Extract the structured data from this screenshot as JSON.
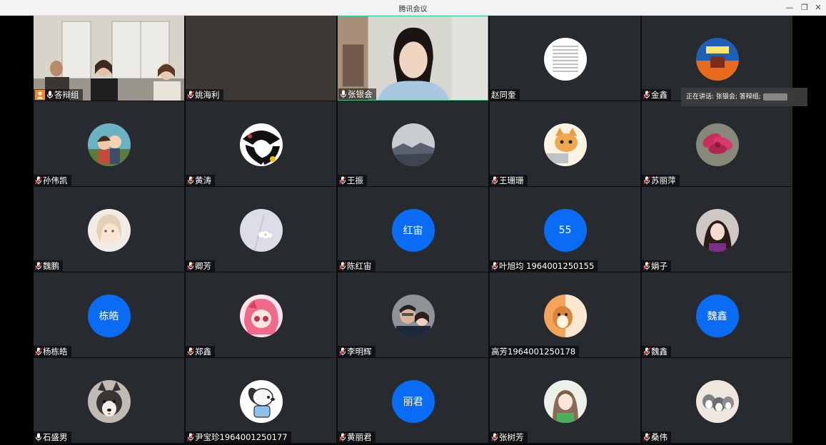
{
  "window": {
    "title": "腾讯会议"
  },
  "speaking_banner": {
    "text": "正在讲话: 张银会; 答辩组;"
  },
  "participants": [
    {
      "name": "答辩组",
      "host": true,
      "mic": "on",
      "type": "video"
    },
    {
      "name": "姚海利",
      "mic": "off",
      "type": "blank"
    },
    {
      "name": "张银会",
      "mic": "on",
      "type": "video",
      "active": true
    },
    {
      "name": "赵同奎",
      "mic": "none",
      "type": "avatar",
      "avatar_icon": "document-avatar"
    },
    {
      "name": "金鑫",
      "mic": "off",
      "type": "avatar",
      "avatar_icon": "building-avatar"
    },
    {
      "name": "孙伟凯",
      "mic": "off",
      "type": "avatar",
      "avatar_icon": "cartoon-couple-avatar"
    },
    {
      "name": "黄涛",
      "mic": "off",
      "type": "avatar",
      "avatar_icon": "pattern-avatar"
    },
    {
      "name": "王振",
      "mic": "off",
      "type": "avatar",
      "avatar_icon": "snow-mountain-avatar"
    },
    {
      "name": "王珊珊",
      "mic": "off",
      "type": "avatar",
      "avatar_icon": "cat-avatar"
    },
    {
      "name": "苏丽萍",
      "mic": "off",
      "type": "avatar",
      "avatar_icon": "flower-avatar"
    },
    {
      "name": "魏鹏",
      "mic": "off",
      "type": "avatar",
      "avatar_icon": "girl-drawing-avatar"
    },
    {
      "name": "卿芳",
      "mic": "off",
      "type": "avatar",
      "avatar_icon": "white-flower-avatar"
    },
    {
      "name": "陈红宙",
      "mic": "off",
      "type": "text",
      "avatar_text": "红宙"
    },
    {
      "name": "叶旭均 1964001250155",
      "mic": "off",
      "type": "text",
      "avatar_text": "55"
    },
    {
      "name": "娟子",
      "mic": "off",
      "type": "avatar",
      "avatar_icon": "woman-photo-avatar"
    },
    {
      "name": "杨栋皓",
      "mic": "off",
      "type": "text",
      "avatar_text": "栋皓"
    },
    {
      "name": "郑鑫",
      "mic": "off",
      "type": "avatar",
      "avatar_icon": "anime-girl-avatar"
    },
    {
      "name": "李明辉",
      "mic": "off",
      "type": "avatar",
      "avatar_icon": "couple-photo-avatar"
    },
    {
      "name": "高芳1964001250178",
      "mic": "none",
      "type": "avatar",
      "avatar_icon": "squirrel-avatar"
    },
    {
      "name": "魏鑫",
      "mic": "off",
      "type": "text",
      "avatar_text": "魏鑫"
    },
    {
      "name": "石盛男",
      "mic": "on",
      "type": "avatar",
      "avatar_icon": "husky-dog-avatar"
    },
    {
      "name": "尹宝珍1964001250177",
      "mic": "off",
      "type": "avatar",
      "avatar_icon": "cartoon-dog-avatar"
    },
    {
      "name": "黄丽君",
      "mic": "off",
      "type": "text",
      "avatar_text": "丽君"
    },
    {
      "name": "张树芳",
      "mic": "off",
      "type": "avatar",
      "avatar_icon": "girl-portrait-avatar"
    },
    {
      "name": "桑伟",
      "mic": "off",
      "type": "avatar",
      "avatar_icon": "husky-puppies-avatar"
    }
  ]
}
